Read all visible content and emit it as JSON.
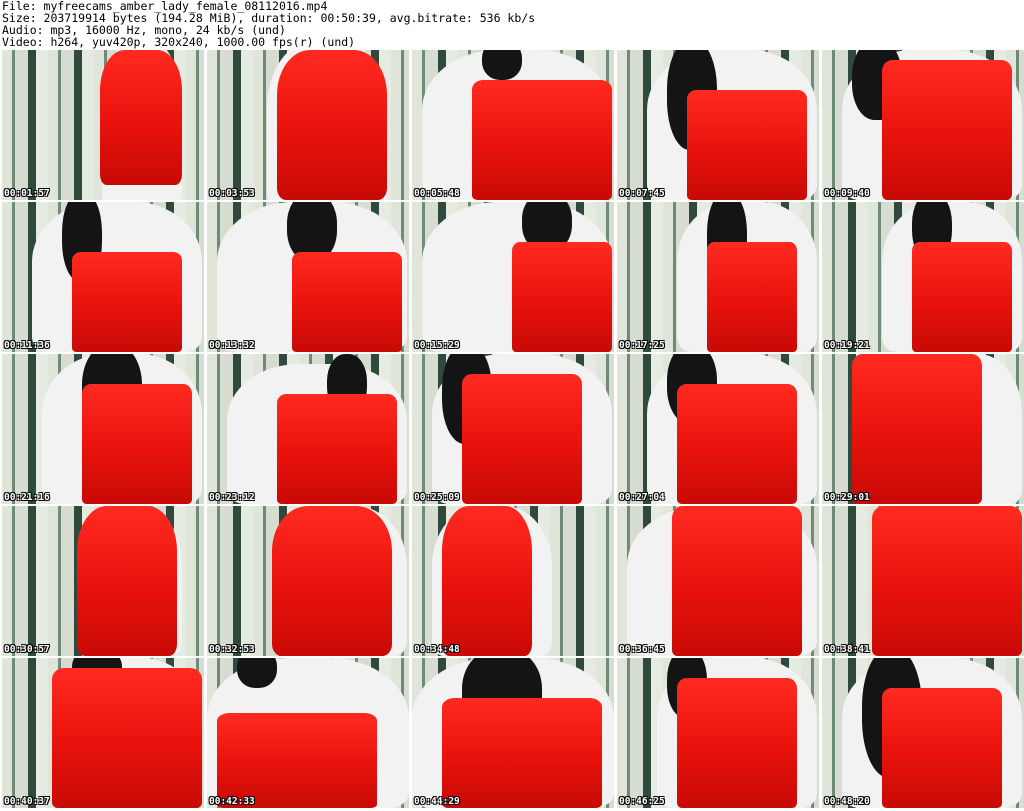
{
  "header": {
    "file": "File: myfreecams_amber_lady_female_08112016.mp4",
    "size": "Size: 203719914 bytes (194.28 MiB), duration: 00:50:39, avg.bitrate: 536 kb/s",
    "audio": "Audio: mp3, 16000 Hz, mono, 24 kb/s (und)",
    "video": "Video: h264, yuv420p, 320x240, 1000.00 fps(r) (und)"
  },
  "thumbnails": [
    {
      "timestamp": "00:01:57"
    },
    {
      "timestamp": "00:03:53"
    },
    {
      "timestamp": "00:05:48"
    },
    {
      "timestamp": "00:07:45"
    },
    {
      "timestamp": "00:09:40"
    },
    {
      "timestamp": "00:11:36"
    },
    {
      "timestamp": "00:13:32"
    },
    {
      "timestamp": "00:15:29"
    },
    {
      "timestamp": "00:17:25"
    },
    {
      "timestamp": "00:19:21"
    },
    {
      "timestamp": "00:21:16"
    },
    {
      "timestamp": "00:23:12"
    },
    {
      "timestamp": "00:25:09"
    },
    {
      "timestamp": "00:27:04"
    },
    {
      "timestamp": "00:29:01"
    },
    {
      "timestamp": "00:30:57"
    },
    {
      "timestamp": "00:32:53"
    },
    {
      "timestamp": "00:34:48"
    },
    {
      "timestamp": "00:36:45"
    },
    {
      "timestamp": "00:38:41"
    },
    {
      "timestamp": "00:40:37"
    },
    {
      "timestamp": "00:42:33"
    },
    {
      "timestamp": "00:44:29"
    },
    {
      "timestamp": "00:46:25"
    },
    {
      "timestamp": "00:48:20"
    }
  ]
}
